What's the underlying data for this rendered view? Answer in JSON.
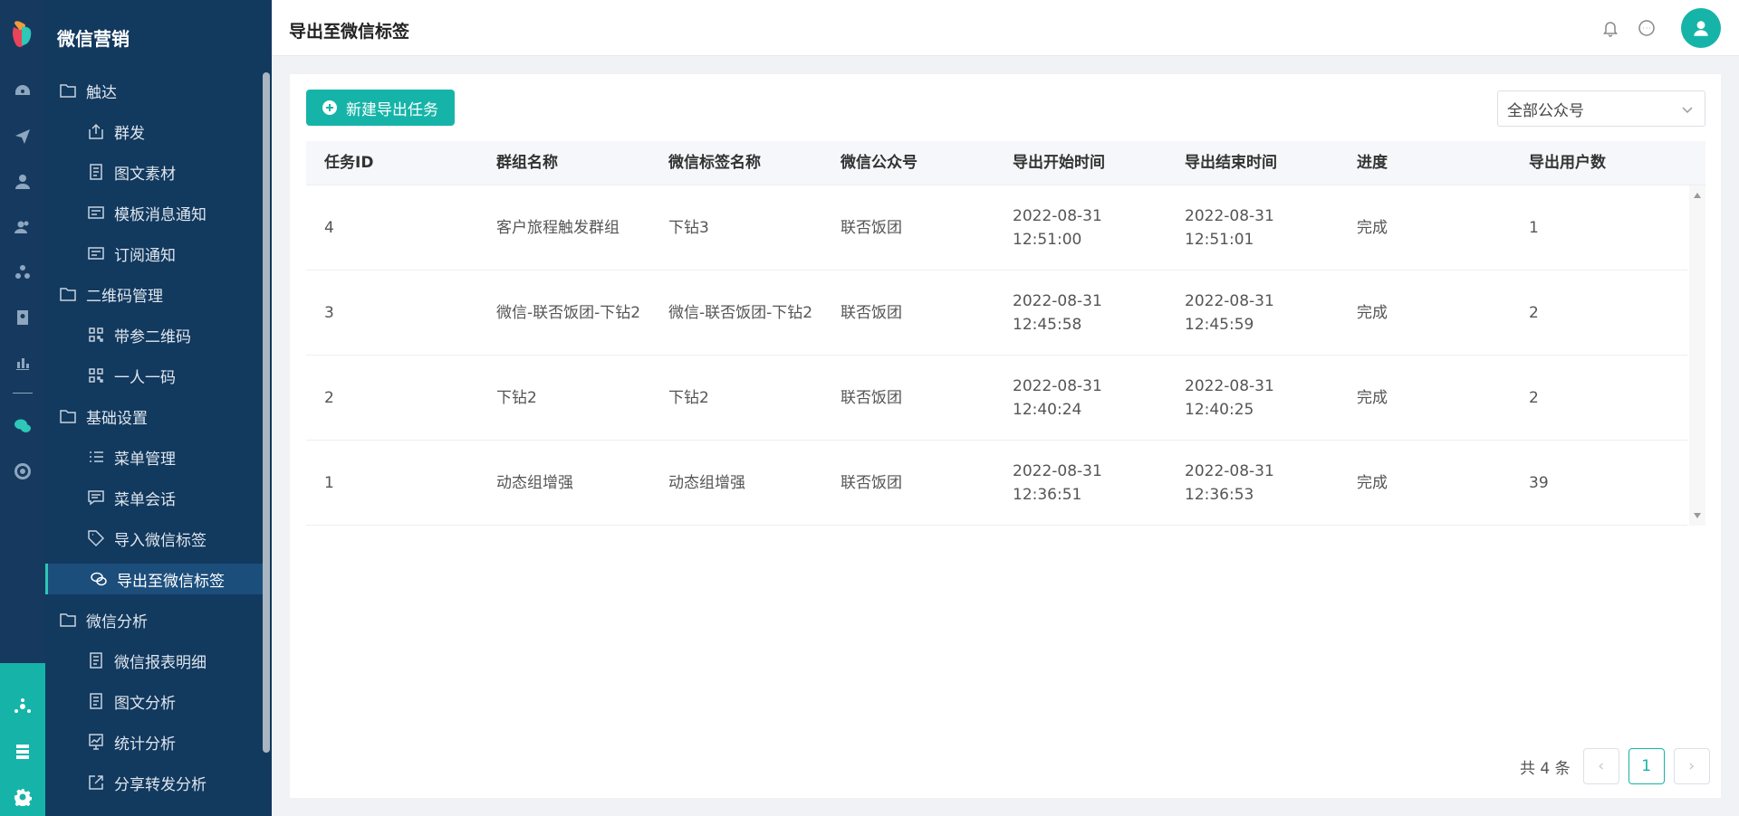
{
  "app": {
    "section_title": "微信营销"
  },
  "header": {
    "page_title": "导出至微信标签"
  },
  "menu": {
    "items": [
      {
        "label": "触达",
        "type": "group",
        "icon": "folder-icon"
      },
      {
        "label": "群发",
        "type": "sub",
        "icon": "upload-icon"
      },
      {
        "label": "图文素材",
        "type": "sub",
        "icon": "document-icon"
      },
      {
        "label": "模板消息通知",
        "type": "sub",
        "icon": "message-card-icon"
      },
      {
        "label": "订阅通知",
        "type": "sub",
        "icon": "message-card-icon"
      },
      {
        "label": "二维码管理",
        "type": "group",
        "icon": "folder-icon"
      },
      {
        "label": "带参二维码",
        "type": "sub",
        "icon": "qrcode-icon"
      },
      {
        "label": "一人一码",
        "type": "sub",
        "icon": "qrcode-icon"
      },
      {
        "label": "基础设置",
        "type": "group",
        "icon": "folder-icon"
      },
      {
        "label": "菜单管理",
        "type": "sub",
        "icon": "list-icon"
      },
      {
        "label": "菜单会话",
        "type": "sub",
        "icon": "chat-icon"
      },
      {
        "label": "导入微信标签",
        "type": "sub",
        "icon": "tag-icon"
      },
      {
        "label": "导出至微信标签",
        "type": "sub",
        "icon": "wechat-icon",
        "active": true
      },
      {
        "label": "微信分析",
        "type": "group",
        "icon": "folder-icon"
      },
      {
        "label": "微信报表明细",
        "type": "sub",
        "icon": "document-icon"
      },
      {
        "label": "图文分析",
        "type": "sub",
        "icon": "document-icon"
      },
      {
        "label": "统计分析",
        "type": "sub",
        "icon": "chart-icon"
      },
      {
        "label": "分享转发分析",
        "type": "sub",
        "icon": "share-icon"
      }
    ]
  },
  "toolbar": {
    "new_task_label": "新建导出任务",
    "account_select_value": "全部公众号"
  },
  "table": {
    "columns": [
      "任务ID",
      "群组名称",
      "微信标签名称",
      "微信公众号",
      "导出开始时间",
      "导出结束时间",
      "进度",
      "导出用户数"
    ],
    "rows": [
      {
        "id": "4",
        "group": "客户旅程触发群组",
        "tag": "下钻3",
        "account": "联否饭团",
        "start_date": "2022-08-31",
        "start_time": "12:51:00",
        "end_date": "2022-08-31",
        "end_time": "12:51:01",
        "progress": "完成",
        "users": "1"
      },
      {
        "id": "3",
        "group": "微信-联否饭团-下钻2",
        "tag": "微信-联否饭团-下钻2",
        "account": "联否饭团",
        "start_date": "2022-08-31",
        "start_time": "12:45:58",
        "end_date": "2022-08-31",
        "end_time": "12:45:59",
        "progress": "完成",
        "users": "2"
      },
      {
        "id": "2",
        "group": "下钻2",
        "tag": "下钻2",
        "account": "联否饭团",
        "start_date": "2022-08-31",
        "start_time": "12:40:24",
        "end_date": "2022-08-31",
        "end_time": "12:40:25",
        "progress": "完成",
        "users": "2"
      },
      {
        "id": "1",
        "group": "动态组增强",
        "tag": "动态组增强",
        "account": "联否饭团",
        "start_date": "2022-08-31",
        "start_time": "12:36:51",
        "end_date": "2022-08-31",
        "end_time": "12:36:53",
        "progress": "完成",
        "users": "39"
      }
    ]
  },
  "pager": {
    "total_label": "共 4 条",
    "current_page": "1"
  },
  "colors": {
    "accent": "#16b4a8",
    "rail": "#163a5f",
    "menu": "#12395e"
  }
}
